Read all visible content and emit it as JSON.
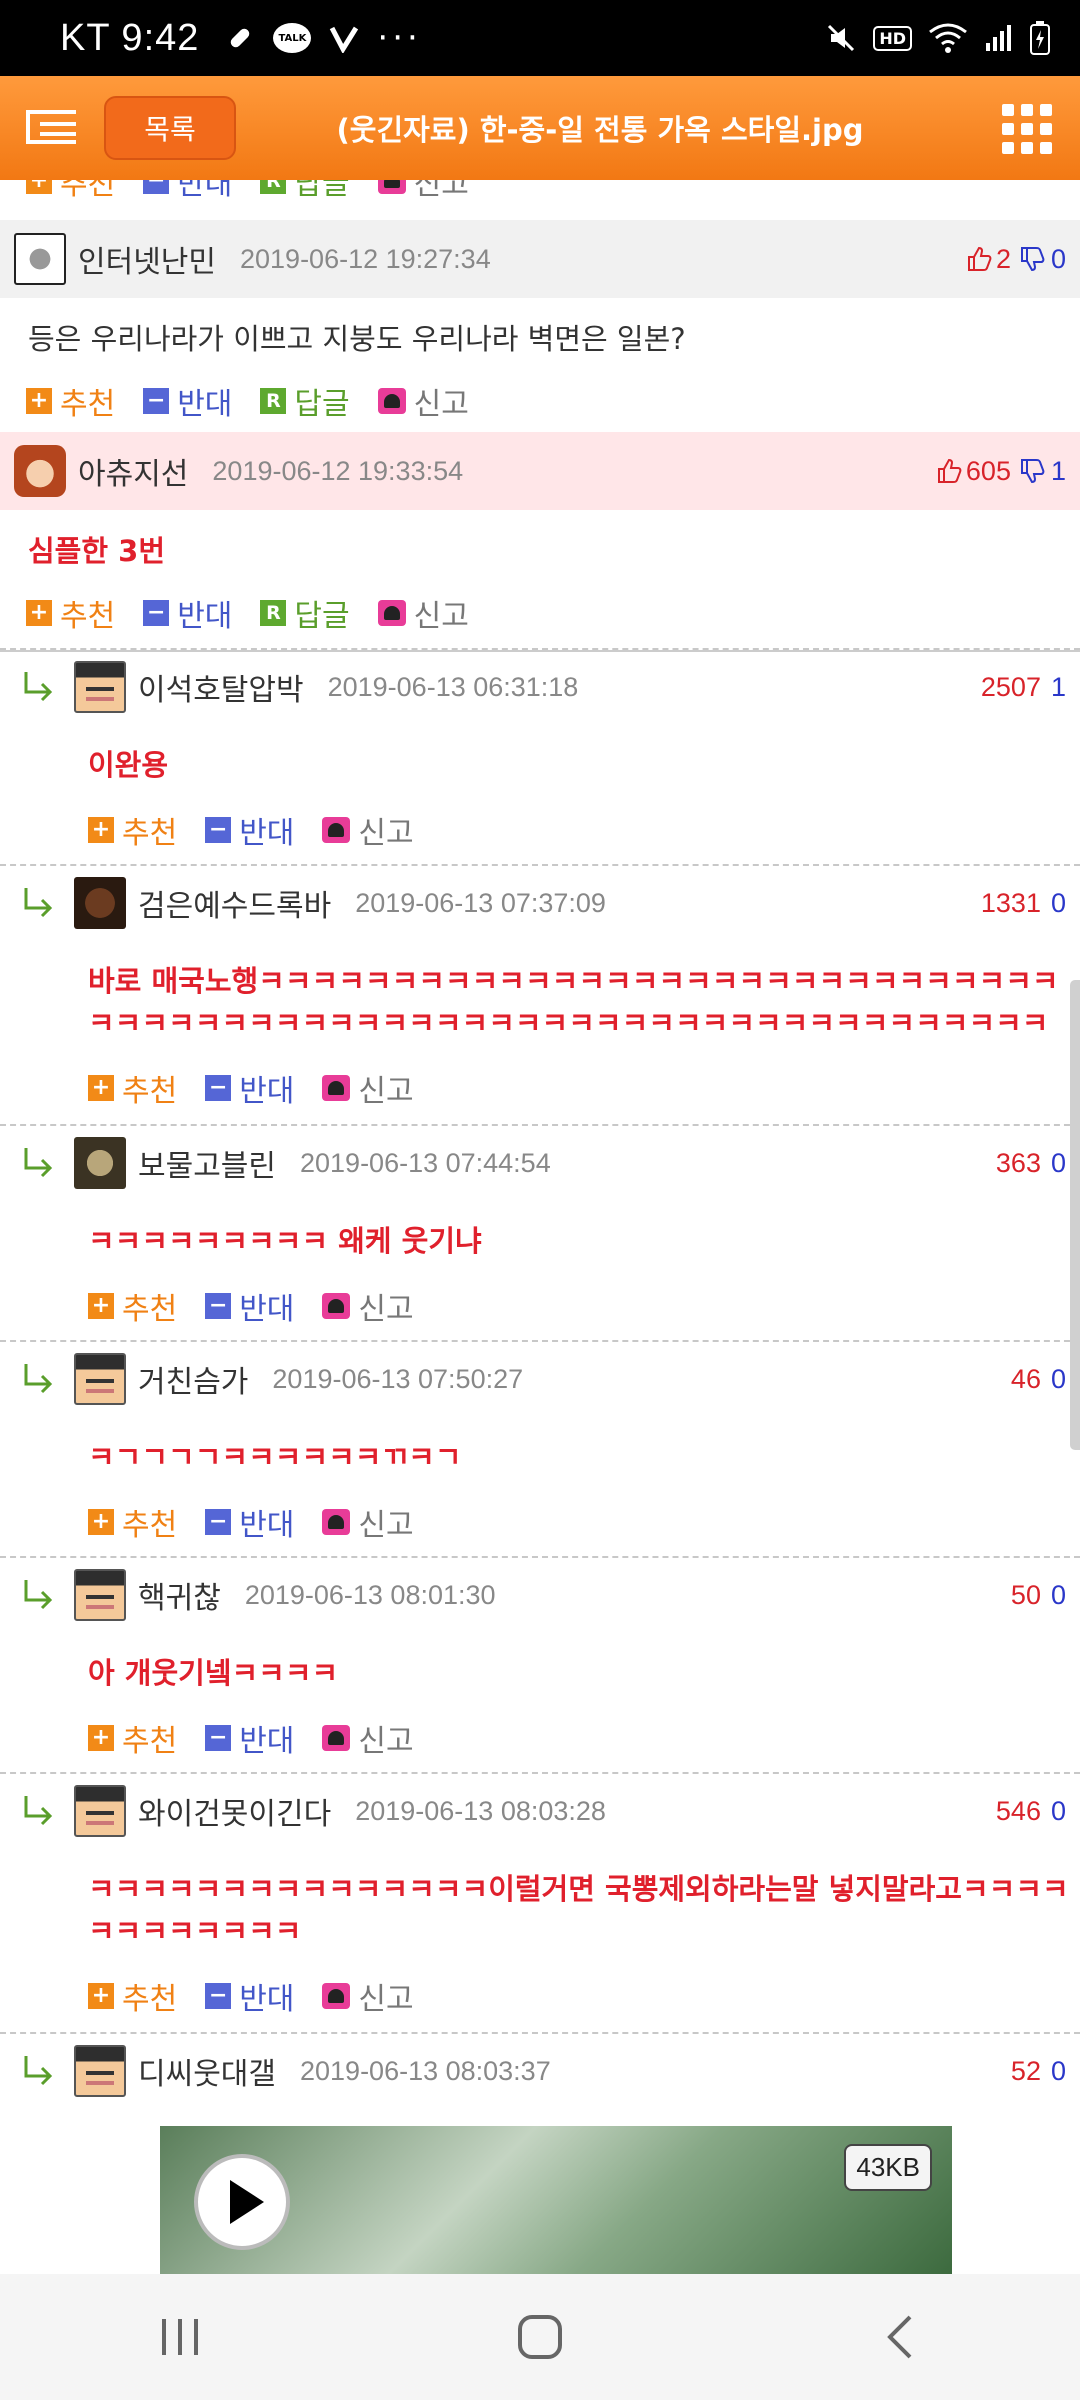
{
  "status_bar": {
    "carrier_time": "KT 9:42",
    "more": "···",
    "hd": "HD",
    "icons": [
      "pill-icon",
      "kakaotalk-icon",
      "v-app-icon",
      "mute-icon",
      "wifi-icon",
      "signal-icon",
      "battery-icon"
    ],
    "talk_label": "TALK"
  },
  "header": {
    "list_button": "목록",
    "title": "(웃긴자료) 한-중-일 전통 가옥 스타일.jpg",
    "color": "#f58220"
  },
  "actions": {
    "recommend": "추천",
    "oppose": "반대",
    "reply": "답글",
    "report": "신고",
    "recommend_box": "+",
    "oppose_box": "−",
    "reply_box": "R"
  },
  "comments": [
    {
      "user": "인터넷난민",
      "time": "2019-06-12 19:27:34",
      "up": "2",
      "down": "0",
      "text": "등은 우리나라가 이쁘고 지붕도 우리나라 벽면은 일본?"
    },
    {
      "user": "아츄지선",
      "time": "2019-06-12 19:33:54",
      "up": "605",
      "down": "1",
      "text": "심플한 3번"
    }
  ],
  "replies": [
    {
      "user": "이석호탈압박",
      "time": "2019-06-13 06:31:18",
      "up": "2507",
      "down": "1",
      "text": "이완용"
    },
    {
      "user": "검은예수드록바",
      "time": "2019-06-13 07:37:09",
      "up": "1331",
      "down": "0",
      "text": "바로 매국노행ㅋㅋㅋㅋㅋㅋㅋㅋㅋㅋㅋㅋㅋㅋㅋㅋㅋㅋㅋㅋㅋㅋㅋㅋㅋㅋㅋㅋㅋㅋㅋㅋㅋㅋㅋㅋㅋㅋㅋㅋㅋㅋㅋㅋㅋㅋㅋㅋㅋㅋㅋㅋㅋㅋㅋㅋㅋㅋㅋㅋㅋㅋㅋㅋㅋㅋ"
    },
    {
      "user": "보물고블린",
      "time": "2019-06-13 07:44:54",
      "up": "363",
      "down": "0",
      "text": "ㅋㅋㅋㅋㅋㅋㅋㅋㅋ 왜케 웃기냐"
    },
    {
      "user": "거친슴가",
      "time": "2019-06-13 07:50:27",
      "up": "46",
      "down": "0",
      "text": "ㅋㄱㄱㄱㄱㅋㅋㅋㅋㅋㅋㄲㅋㄱ"
    },
    {
      "user": "핵귀찮",
      "time": "2019-06-13 08:01:30",
      "up": "50",
      "down": "0",
      "text": "아 개웃기넼ㅋㅋㅋㅋ"
    },
    {
      "user": "와이건못이긴다",
      "time": "2019-06-13 08:03:28",
      "up": "546",
      "down": "0",
      "text": "ㅋㅋㅋㅋㅋㅋㅋㅋㅋㅋㅋㅋㅋㅋㅋ이럴거면 국뽕제외하라는말 넣지말라고ㅋㅋㅋㅋㅋㅋㅋㅋㅋㅋㅋㅋ"
    },
    {
      "user": "디씨웃대갤",
      "time": "2019-06-13 08:03:37",
      "up": "52",
      "down": "0"
    }
  ],
  "video": {
    "size": "43KB"
  }
}
